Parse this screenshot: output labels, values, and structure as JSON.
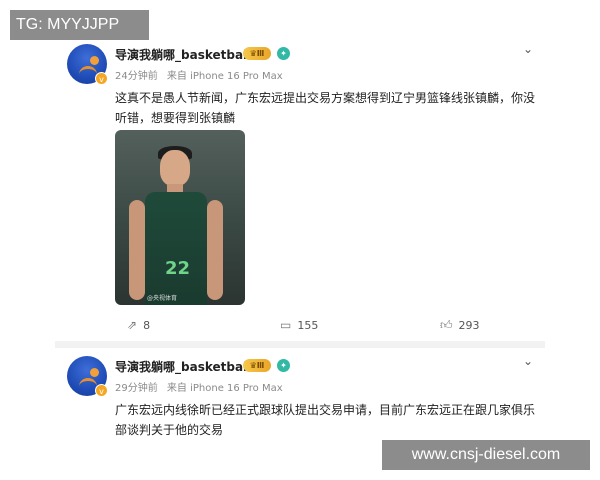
{
  "watermarks": {
    "top": "TG: MYYJJPP",
    "bottom": "www.cnsj-diesel.com"
  },
  "posts": [
    {
      "username": "导演我躺哪_basketball",
      "vip_badge": "Ⅲ",
      "meta_time": "24分钟前",
      "meta_source": "来自 iPhone 16 Pro Max",
      "text": "这真不是愚人节新闻，广东宏远提出交易方案想得到辽宁男篮锋线张镇麟，你没听错，想要得到张镇麟",
      "photo": {
        "jersey_number": "22",
        "credit": "@央视体育"
      },
      "actions": {
        "share_count": "8",
        "comment_count": "155",
        "like_count": "293"
      }
    },
    {
      "username": "导演我躺哪_basketball",
      "vip_badge": "Ⅲ",
      "meta_time": "29分钟前",
      "meta_source": "来自 iPhone 16 Pro Max",
      "text": "广东宏远内线徐昕已经正式跟球队提出交易申请，目前广东宏远正在跟几家俱乐部谈判关于他的交易"
    }
  ],
  "icons": {
    "share": "share-icon",
    "comment": "comment-icon",
    "like": "like-icon",
    "chevron": "chevron-down-icon",
    "verify": "verified-icon"
  },
  "colors": {
    "username": "#222222",
    "meta": "#8a8a8a",
    "vip": "#e8a62a",
    "verify": "#31b9a6",
    "divider": "#f2f2f2",
    "watermark_bg": "#8c8c8c"
  }
}
